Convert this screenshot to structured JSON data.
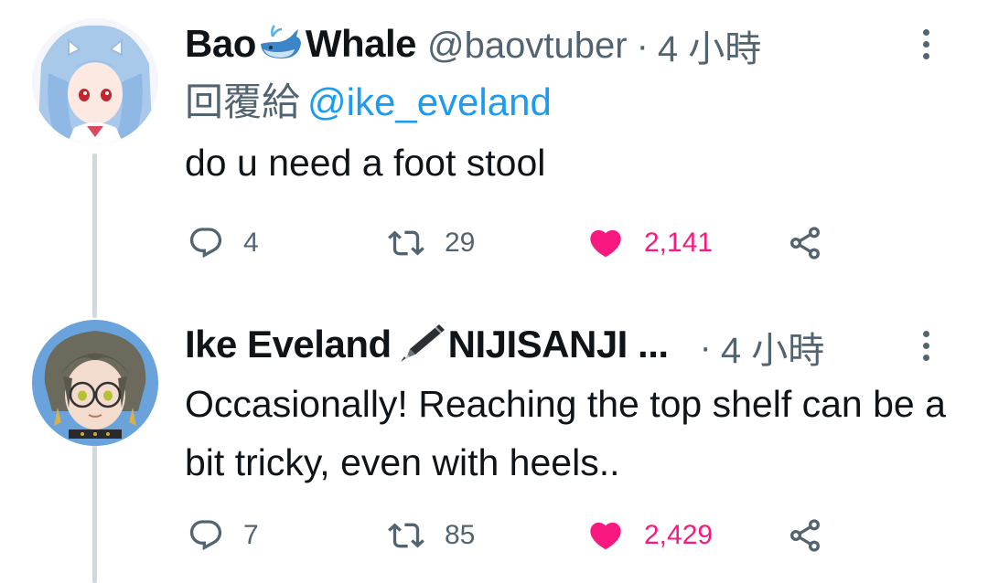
{
  "tweets": [
    {
      "display_name_prefix": "Bao",
      "display_name_suffix": "Whale",
      "name_emoji": "whale-emoji",
      "handle": "@baovtuber",
      "separator": "·",
      "time": "4 小時",
      "reply_prefix": "回覆給",
      "reply_mention": "@ike_eveland",
      "text": "do u need a foot stool",
      "replies": "4",
      "retweets": "29",
      "likes": "2,141",
      "liked": true
    },
    {
      "display_name_prefix": "Ike Eveland",
      "display_name_suffix": "NIJISANJI ...",
      "name_emoji": "fountain-pen-emoji",
      "separator": "·",
      "time": "4 小時",
      "text": "Occasionally! Reaching the top shelf can be a bit tricky, even with heels..",
      "replies": "7",
      "retweets": "85",
      "likes": "2,429",
      "liked": true
    }
  ],
  "colors": {
    "like": "#f91880",
    "mention": "#1d9bf0",
    "secondary_text": "#536471",
    "thread_line": "#cfd9de"
  }
}
